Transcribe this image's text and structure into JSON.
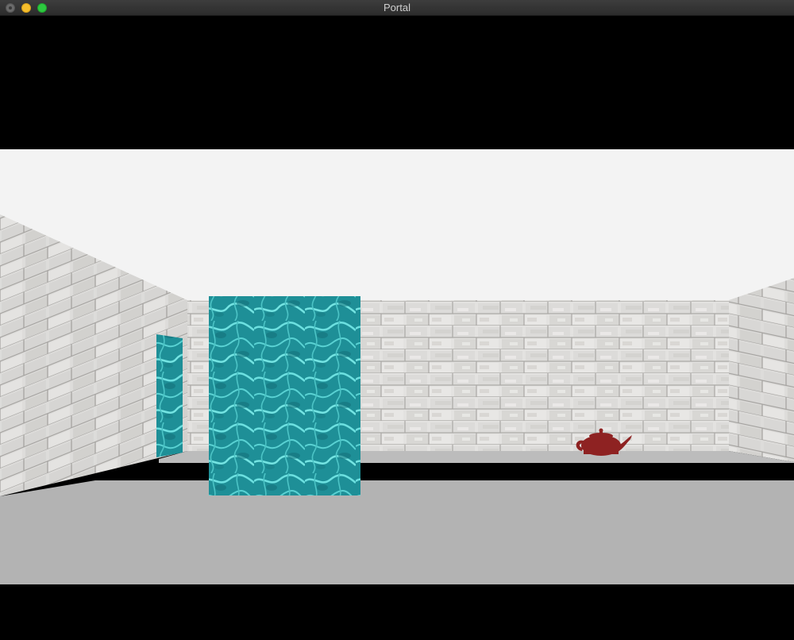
{
  "window": {
    "title": "Portal",
    "buttons": [
      "close",
      "minimize",
      "maximize"
    ]
  },
  "scene": {
    "ceiling_color": "#f3f3f3",
    "floor_color": "#b3b3b3",
    "void_color": "#000000",
    "wall_texture": "white-brick",
    "portal_texture": "water",
    "portal_color": "#2aa0a8",
    "teapot_color": "#8e2222"
  }
}
